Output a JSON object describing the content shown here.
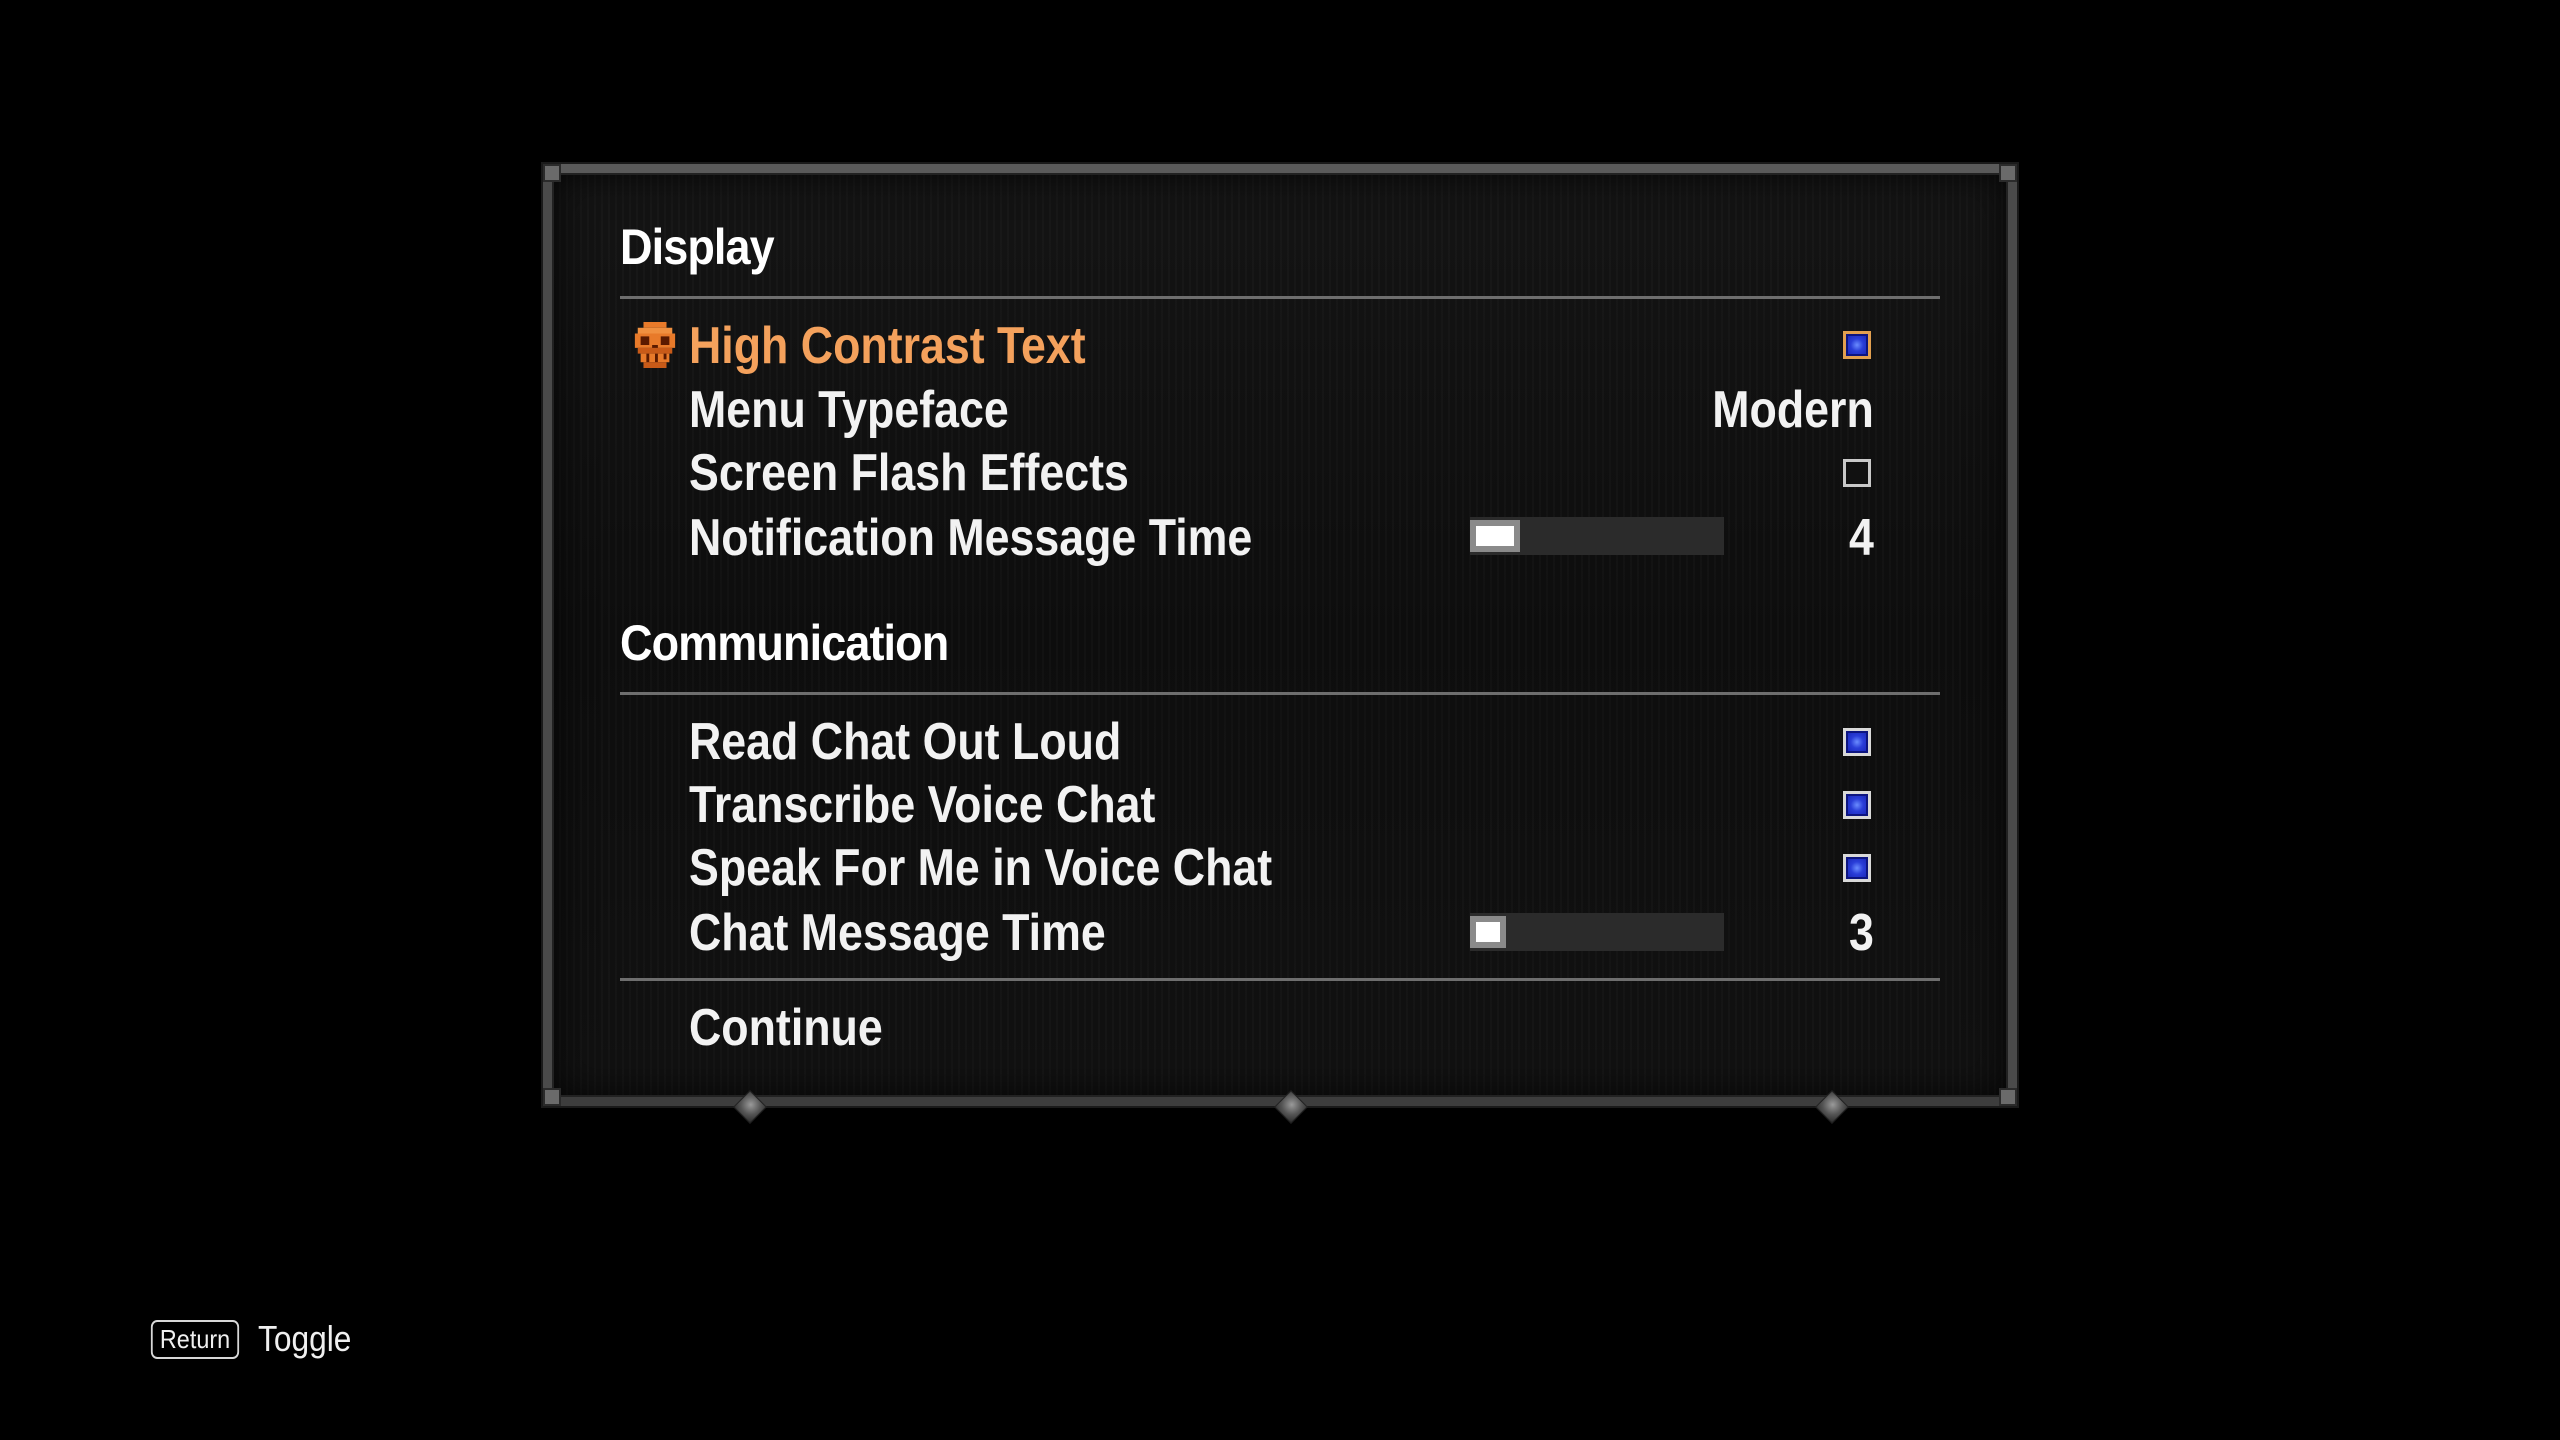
{
  "sections": {
    "display": {
      "title": "Display",
      "high_contrast_text": {
        "label": "High Contrast Text",
        "checked": true
      },
      "menu_typeface": {
        "label": "Menu Typeface",
        "value": "Modern"
      },
      "screen_flash_effects": {
        "label": "Screen Flash Effects",
        "checked": false
      },
      "notification_message_time": {
        "label": "Notification Message Time",
        "value": "4"
      }
    },
    "communication": {
      "title": "Communication",
      "read_chat_out_loud": {
        "label": "Read Chat Out Loud",
        "checked": true
      },
      "transcribe_voice_chat": {
        "label": "Transcribe Voice Chat",
        "checked": true
      },
      "speak_for_me": {
        "label": "Speak For Me in Voice Chat",
        "checked": true
      },
      "chat_message_time": {
        "label": "Chat Message Time",
        "value": "3"
      }
    }
  },
  "continue_label": "Continue",
  "hint": {
    "key": "Return",
    "action": "Toggle"
  },
  "colors": {
    "selected_text": "#f4a15c",
    "checkbox_checked": "#2a3ed8",
    "text": "#f2f2f2",
    "divider": "#6e6e6e"
  },
  "icons": {
    "selection_cursor": "skull-icon"
  }
}
